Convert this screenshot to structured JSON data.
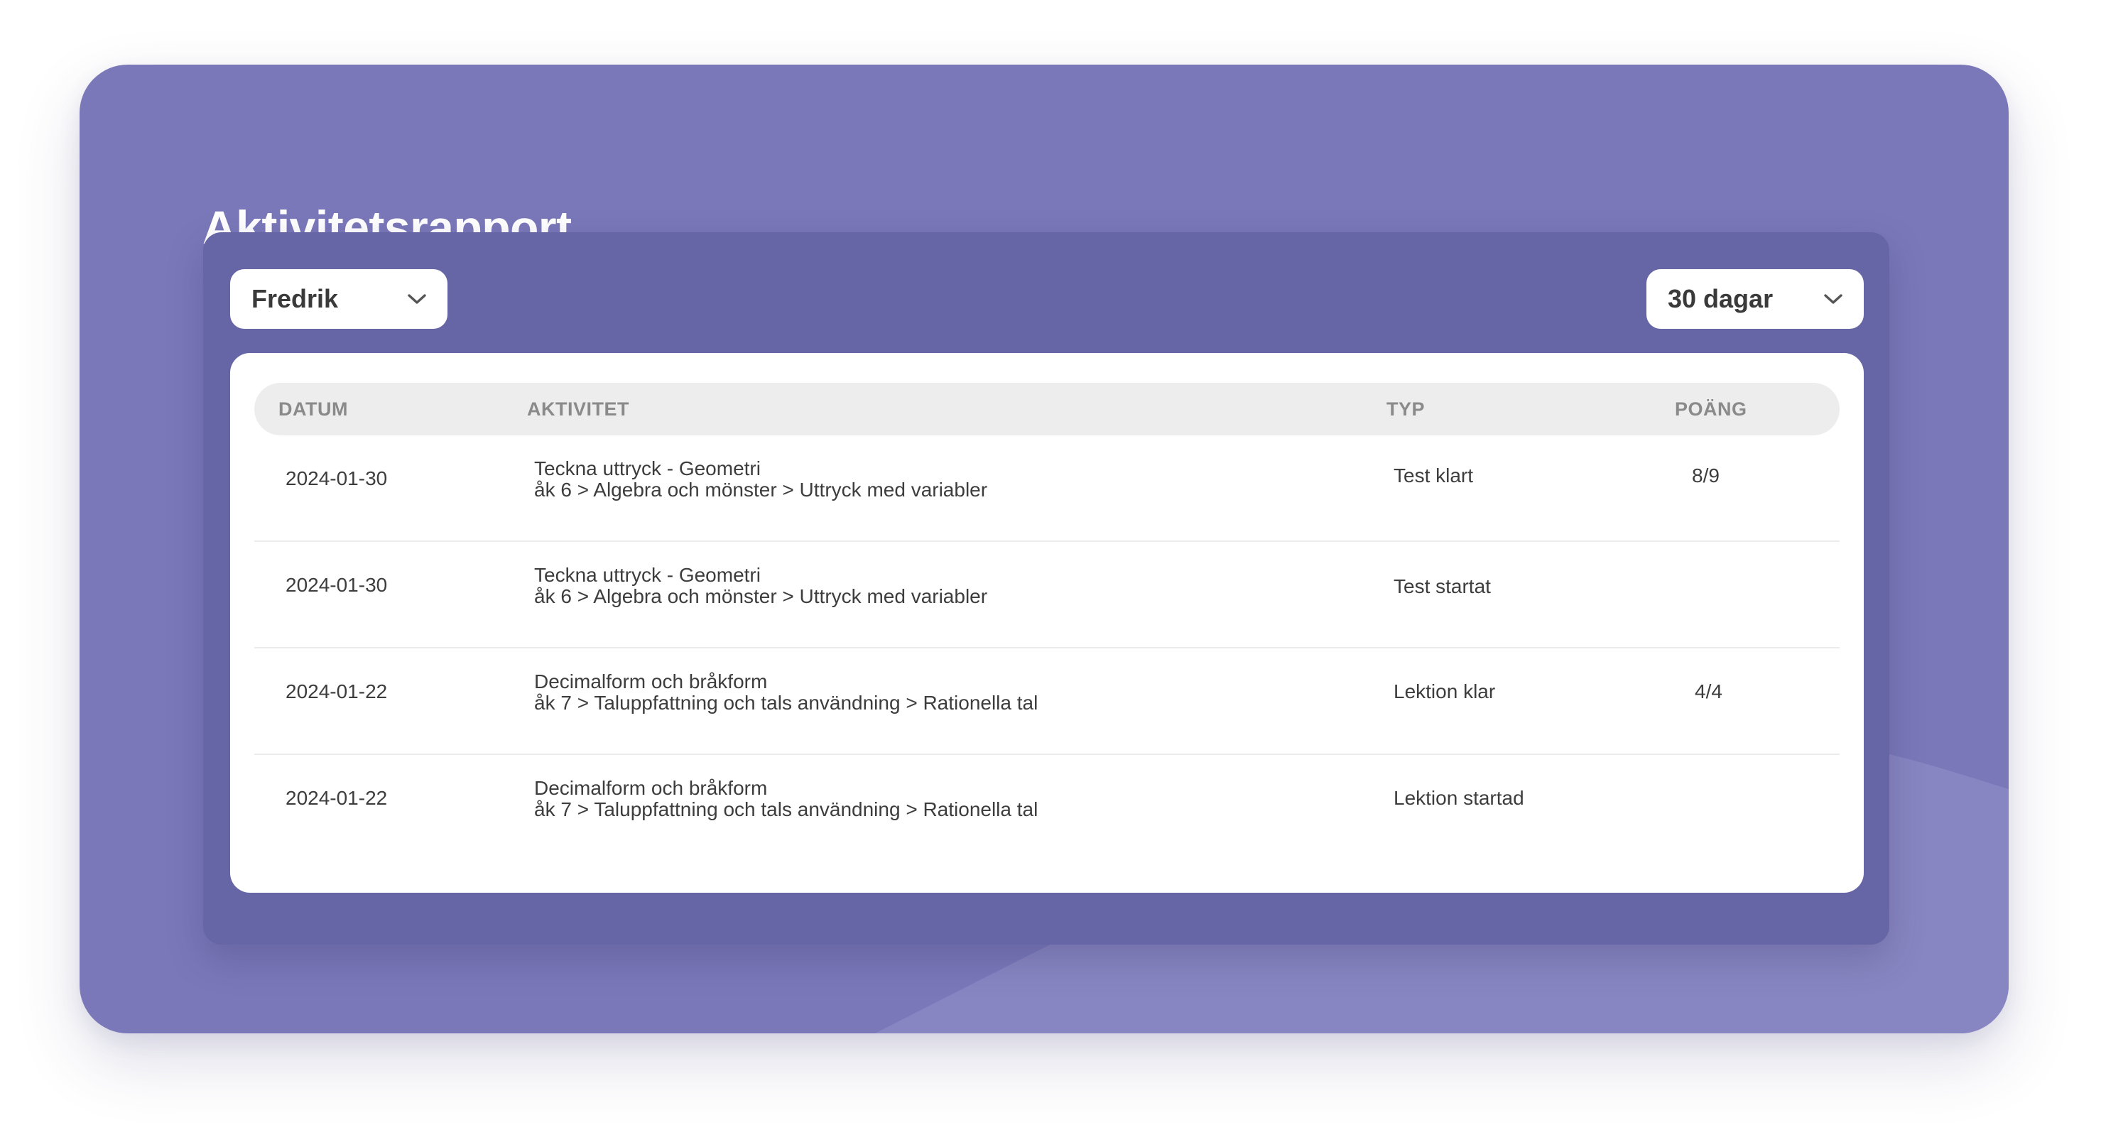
{
  "page": {
    "title": "Aktivitetsrapport"
  },
  "filters": {
    "student": {
      "selected": "Fredrik",
      "icon": "chevron-down-icon"
    },
    "period": {
      "selected": "30 dagar",
      "icon": "chevron-down-icon"
    }
  },
  "table": {
    "headers": {
      "date": "DATUM",
      "activity": "AKTIVITET",
      "type": "TYP",
      "points": "POÄNG"
    },
    "rows": [
      {
        "date": "2024-01-30",
        "activity_title": "Teckna uttryck - Geometri",
        "activity_path": "åk 6 > Algebra och mönster > Uttryck med variabler",
        "type": "Test klart",
        "points": "8/9"
      },
      {
        "date": "2024-01-30",
        "activity_title": "Teckna uttryck - Geometri",
        "activity_path": "åk 6 > Algebra och mönster > Uttryck med variabler",
        "type": "Test startat",
        "points": ""
      },
      {
        "date": "2024-01-22",
        "activity_title": "Decimalform och bråkform",
        "activity_path": "åk 7 > Taluppfattning och tals användning > Rationella tal",
        "type": "Lektion klar",
        "points": "4/4"
      },
      {
        "date": "2024-01-22",
        "activity_title": "Decimalform och bråkform",
        "activity_path": "åk 7 > Taluppfattning och tals användning > Rationella tal",
        "type": "Lektion startad",
        "points": ""
      }
    ]
  },
  "colors": {
    "card_background": "#7a78b9",
    "panel_background": "#6665a5",
    "wave_highlight": "#8886c2",
    "header_background": "#ededed"
  }
}
